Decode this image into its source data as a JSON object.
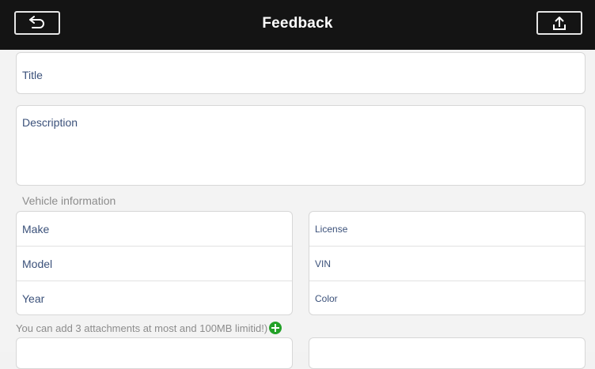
{
  "header": {
    "title": "Feedback",
    "back_icon": "back-arrow-icon",
    "upload_icon": "upload-icon"
  },
  "form": {
    "title_placeholder": "Title",
    "description_placeholder": "Description"
  },
  "vehicle": {
    "section_label": "Vehicle information",
    "left_fields": [
      "Make",
      "Model",
      "Year"
    ],
    "right_fields": [
      "License",
      "VIN",
      "Color"
    ]
  },
  "attachments": {
    "hint": "You can add 3 attachments at most and 100MB limitid!)",
    "add_icon": "add-circle-icon"
  },
  "colors": {
    "topbar": "#141414",
    "accent_add": "#23a128",
    "field_text": "#3b517a"
  }
}
